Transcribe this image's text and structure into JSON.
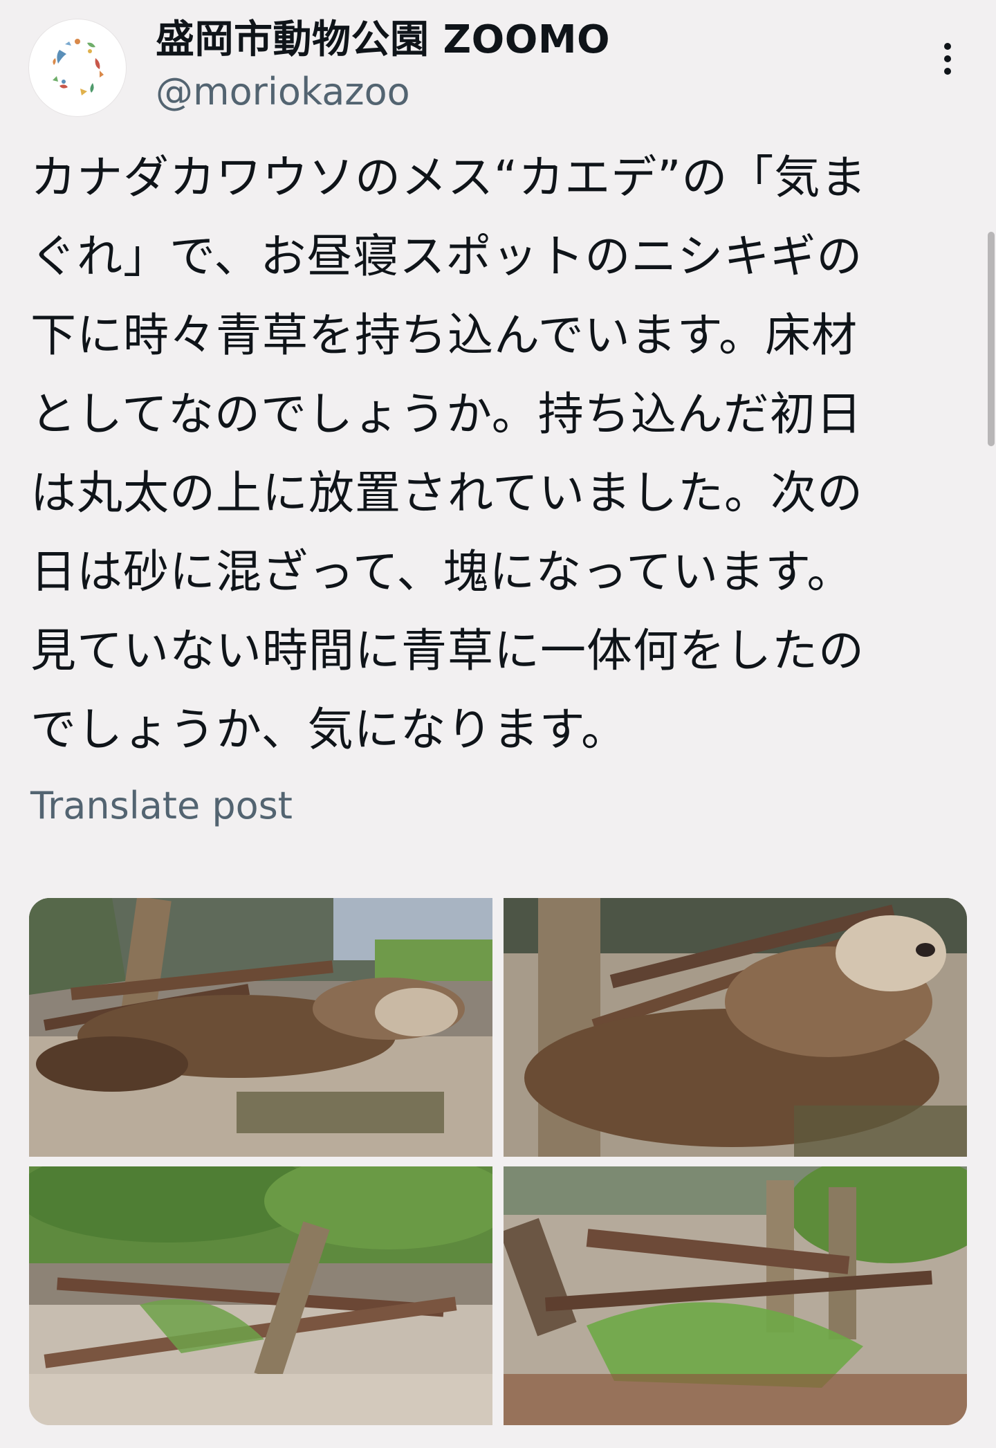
{
  "post": {
    "display_name": "盛岡市動物公園 ZOOMO",
    "handle": "@moriokazoo",
    "text": "カナダカワウソのメス“カエデ”の「気ま\nぐれ」で、お昼寝スポットのニシキギの\n下に時々青草を持ち込んでいます。床材\nとしてなのでしょうか。持ち込んだ初日\nは丸太の上に放置されていました。次の\n日は砂に混ざって、塊になっています。\n見ていない時間に青草に一体何をしたの\nでしょうか、気になります。",
    "translate_label": "Translate post"
  },
  "icons": {
    "more": "more-vertical-icon",
    "avatar": "zoo-logo"
  },
  "media": {
    "count": 4,
    "subjects": [
      "otter-sleeping-wide",
      "otter-sleeping-close",
      "logs-under-tree",
      "logs-with-grass"
    ]
  },
  "colors": {
    "background": "#f2f0f1",
    "text": "#0f1419",
    "secondary_text": "#536471"
  }
}
